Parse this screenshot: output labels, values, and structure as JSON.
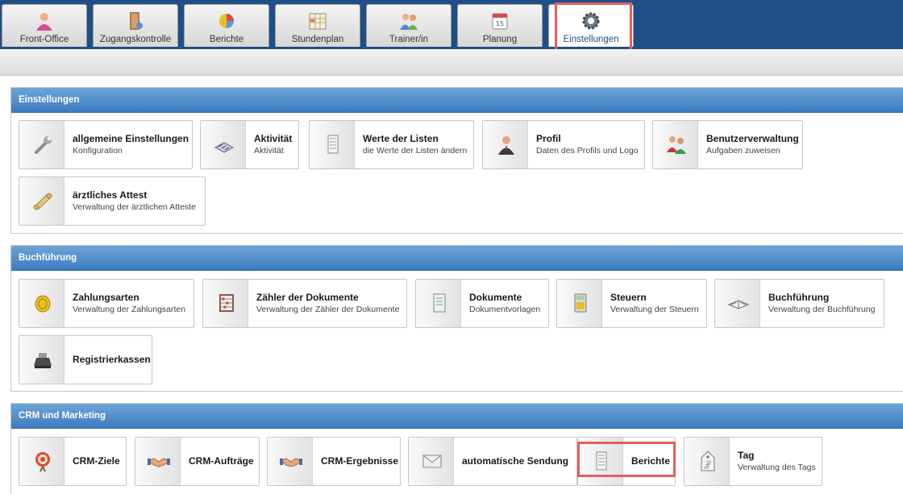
{
  "nav": {
    "tabs": [
      {
        "label": "Front-Office",
        "icon": "person-icon",
        "active": false
      },
      {
        "label": "Zugangskontrolle",
        "icon": "door-icon",
        "active": false
      },
      {
        "label": "Berichte",
        "icon": "pie-chart-icon",
        "active": false
      },
      {
        "label": "Stundenplan",
        "icon": "calendar-grid-icon",
        "active": false
      },
      {
        "label": "Trainer/in",
        "icon": "people-icon",
        "active": false
      },
      {
        "label": "Planung",
        "icon": "calendar-icon",
        "active": false
      },
      {
        "label": "Einstellungen",
        "icon": "gear-icon",
        "active": true
      }
    ]
  },
  "sections": [
    {
      "title": "Einstellungen",
      "items": [
        {
          "title": "allgemeine Einstellungen",
          "subtitle": "Konfiguration",
          "icon": "wrench-icon"
        },
        {
          "title": "Aktivität",
          "subtitle": "Aktivität",
          "icon": "activity-icon"
        },
        {
          "title": "Werte der Listen",
          "subtitle": "die Werte der Listen ändern",
          "icon": "list-document-icon"
        },
        {
          "title": "Profil",
          "subtitle": "Daten des Profils und Logo",
          "icon": "profile-icon"
        },
        {
          "title": "Benutzerverwaltung",
          "subtitle": "Aufgaben zuweisen",
          "icon": "users-icon"
        },
        {
          "title": "ärztliches Attest",
          "subtitle": "Verwaltung der ärztlichen Atteste",
          "icon": "scroll-icon"
        }
      ]
    },
    {
      "title": "Buchführung",
      "items": [
        {
          "title": "Zahlungsarten",
          "subtitle": "Verwaltung der Zahlungsarten",
          "icon": "coin-icon"
        },
        {
          "title": "Zähler der Dokumente",
          "subtitle": "Verwaltung der Zähler der Dokumente",
          "icon": "abacus-icon"
        },
        {
          "title": "Dokumente",
          "subtitle": "Dokumentvorlagen",
          "icon": "document-icon"
        },
        {
          "title": "Steuern",
          "subtitle": "Verwaltung der Steuern",
          "icon": "calculator-icon"
        },
        {
          "title": "Buchführung",
          "subtitle": "Verwaltung der Buchführung",
          "icon": "ledger-icon"
        },
        {
          "title": "Registrierkassen",
          "subtitle": "",
          "icon": "cash-register-icon"
        }
      ]
    },
    {
      "title": "CRM und Marketing",
      "items": [
        {
          "title": "CRM-Ziele",
          "subtitle": "",
          "icon": "target-icon"
        },
        {
          "title": "CRM-Aufträge",
          "subtitle": "",
          "icon": "handshake-icon"
        },
        {
          "title": "CRM-Ergebnisse",
          "subtitle": "",
          "icon": "handshake-icon"
        },
        {
          "title": "automatische Sendung",
          "subtitle": "",
          "icon": "envelope-icon"
        },
        {
          "title": "Berichte",
          "subtitle": "",
          "icon": "report-icon"
        },
        {
          "title": "Tag",
          "subtitle": "Verwaltung des Tags",
          "icon": "tag-icon"
        }
      ]
    }
  ]
}
